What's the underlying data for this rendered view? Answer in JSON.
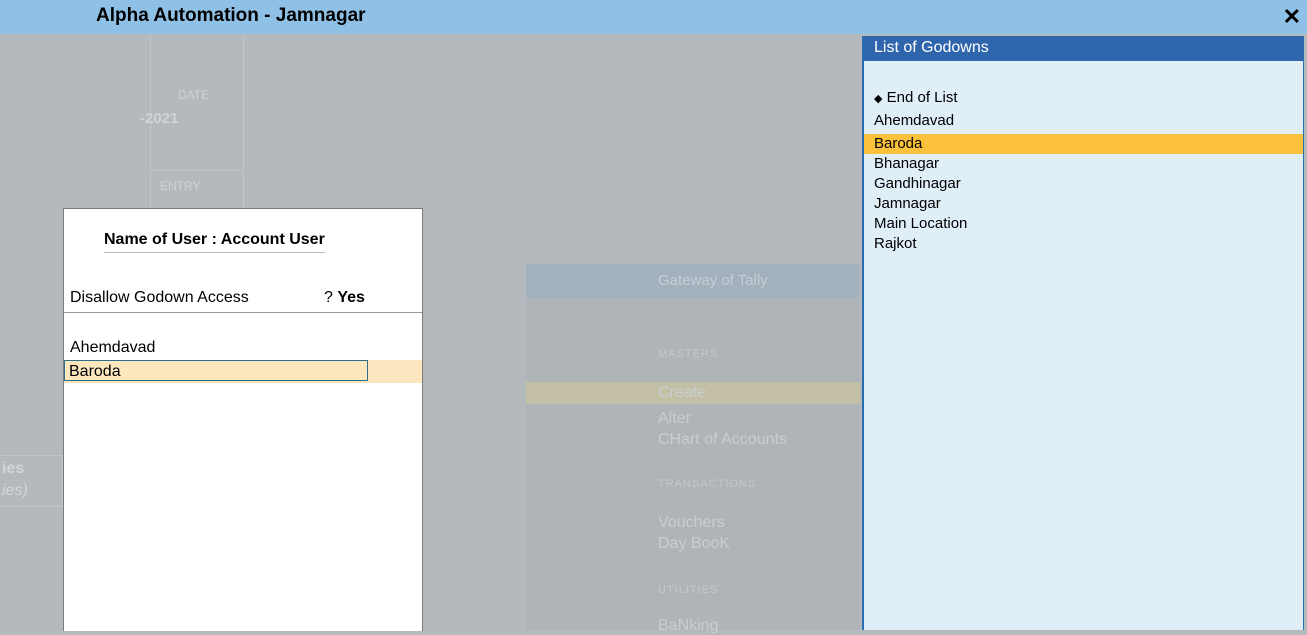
{
  "window": {
    "title": "Alpha Automation - Jamnagar",
    "close_symbol": "✕"
  },
  "background": {
    "date_label": "DATE",
    "date_value": "-2021",
    "entry_label": "ENTRY",
    "edge_text_1": "ies",
    "edge_text_2": "ies)",
    "gateway": {
      "title": "Gateway of Tally",
      "masters_label": "MASTERS",
      "create": "Create",
      "alter": "Alter",
      "chart_of_accounts": "CHart of Accounts",
      "transactions_label": "TRANSACTIONS",
      "vouchers": "Vouchers",
      "day_book": "Day BooK",
      "utilities_label": "UTILITIES",
      "banking": "BaNking"
    }
  },
  "dialog": {
    "title": "Name of User : Account User",
    "question": "Disallow Godown Access",
    "question_mark": "?",
    "answer": "Yes",
    "items": [
      "Ahemdavad"
    ],
    "current_input": "Baroda"
  },
  "list": {
    "title": "List of Godowns",
    "end_of_list": "End of List",
    "items": [
      "Ahemdavad",
      "Baroda",
      "Bhanagar",
      "Gandhinagar",
      "Jamnagar",
      "Main Location",
      "Rajkot"
    ],
    "selected": "Baroda",
    "selected_color": "#fbc13b"
  }
}
